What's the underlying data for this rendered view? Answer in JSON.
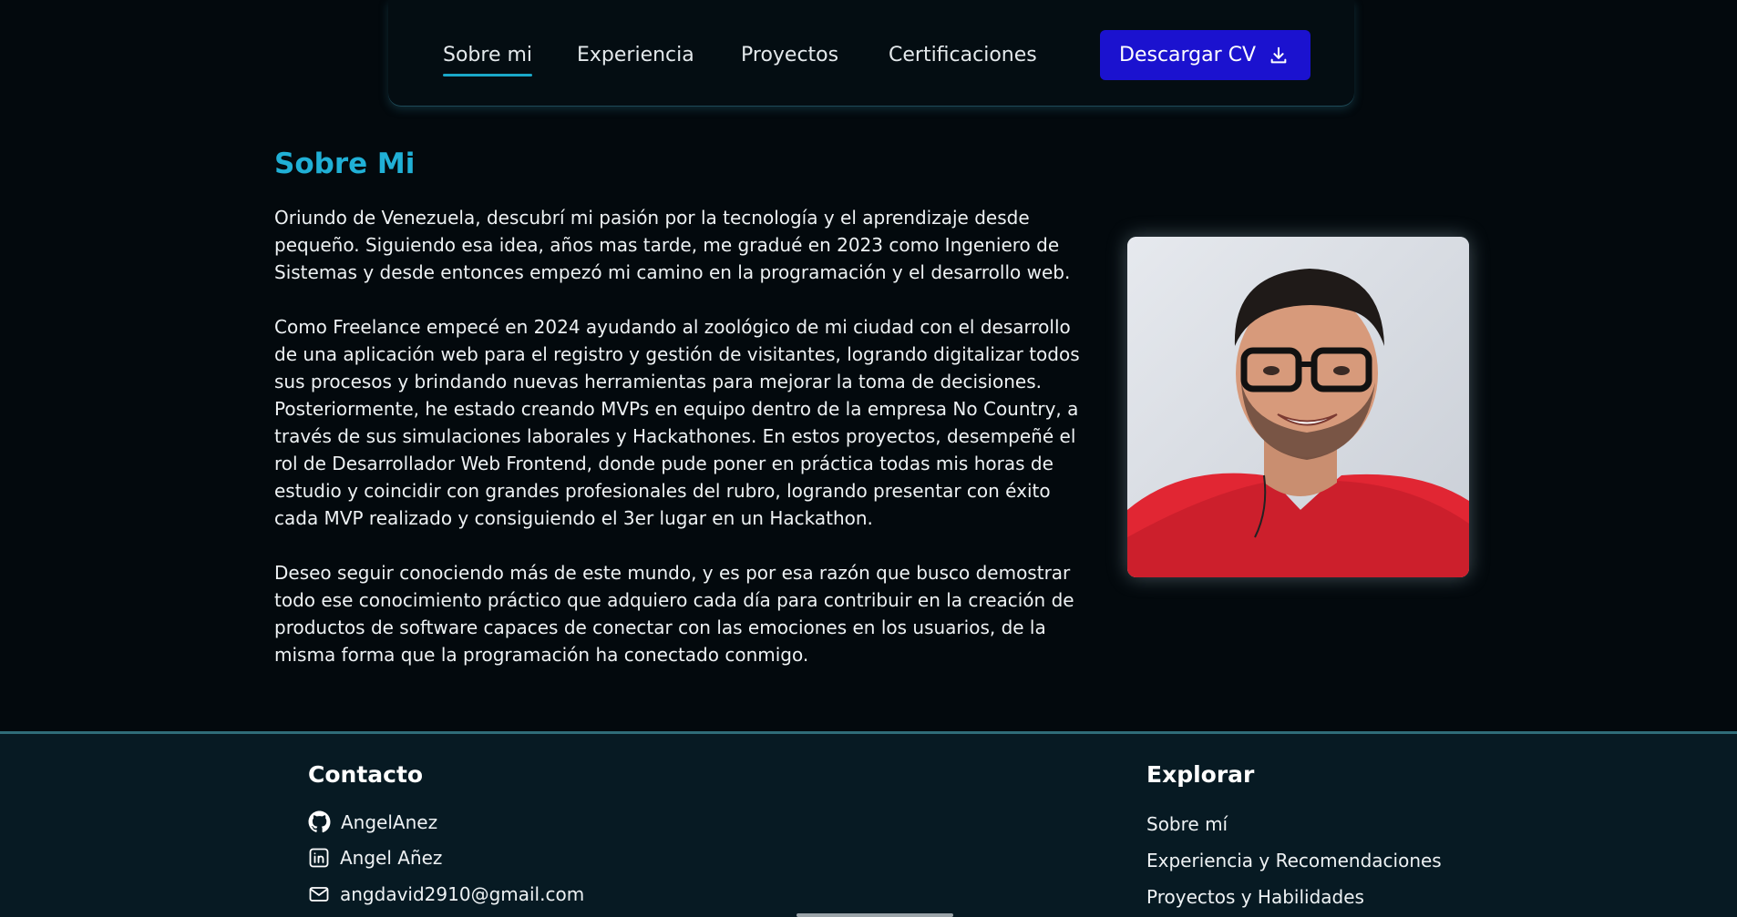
{
  "nav": {
    "items": [
      {
        "label": "Sobre mi",
        "active": true
      },
      {
        "label": "Experiencia",
        "active": false
      },
      {
        "label": "Proyectos",
        "active": false
      },
      {
        "label": "Certificaciones",
        "active": false
      }
    ],
    "cv_button": {
      "label": "Descargar CV",
      "icon": "download-icon"
    }
  },
  "about": {
    "title": "Sobre Mi",
    "paragraphs": [
      "Oriundo de Venezuela, descubrí mi pasión por la tecnología y el aprendizaje desde pequeño. Siguiendo esa idea, años mas tarde, me gradué en 2023 como Ingeniero de Sistemas y desde entonces empezó mi camino en la programación y el desarrollo web.",
      "Como Freelance empecé en 2024 ayudando al zoológico de mi ciudad con el desarrollo de una aplicación web para el registro y gestión de visitantes, logrando digitalizar todos sus procesos y brindando nuevas herramientas para mejorar la toma de decisiones. Posteriormente, he estado creando MVPs en equipo dentro de la empresa No Country, a través de sus simulaciones laborales y Hackathones. En estos proyectos, desempeñé el rol de Desarrollador Web Frontend, donde pude poner en práctica todas mis horas de estudio y coincidir con grandes profesionales del rubro, logrando presentar con éxito cada MVP realizado y consiguiendo el 3er lugar en un Hackathon.",
      "Deseo seguir conociendo más de este mundo, y es por esa razón que busco demostrar todo ese conocimiento práctico que adquiero cada día para contribuir en la creación de productos de software capaces de conectar con las emociones en los usuarios, de la misma forma que la programación ha conectado conmigo."
    ]
  },
  "footer": {
    "contact": {
      "title": "Contacto",
      "items": [
        {
          "icon": "github-icon",
          "label": "AngelAnez"
        },
        {
          "icon": "linkedin-icon",
          "label": "Angel Añez"
        },
        {
          "icon": "mail-icon",
          "label": "angdavid2910@gmail.com"
        }
      ]
    },
    "explore": {
      "title": "Explorar",
      "links": [
        "Sobre mí",
        "Experiencia y Recomendaciones",
        "Proyectos y Habilidades"
      ]
    }
  },
  "colors": {
    "background": "#03090d",
    "accent": "#20b0d6",
    "button": "#1b12cf",
    "footer": "#071a23"
  }
}
